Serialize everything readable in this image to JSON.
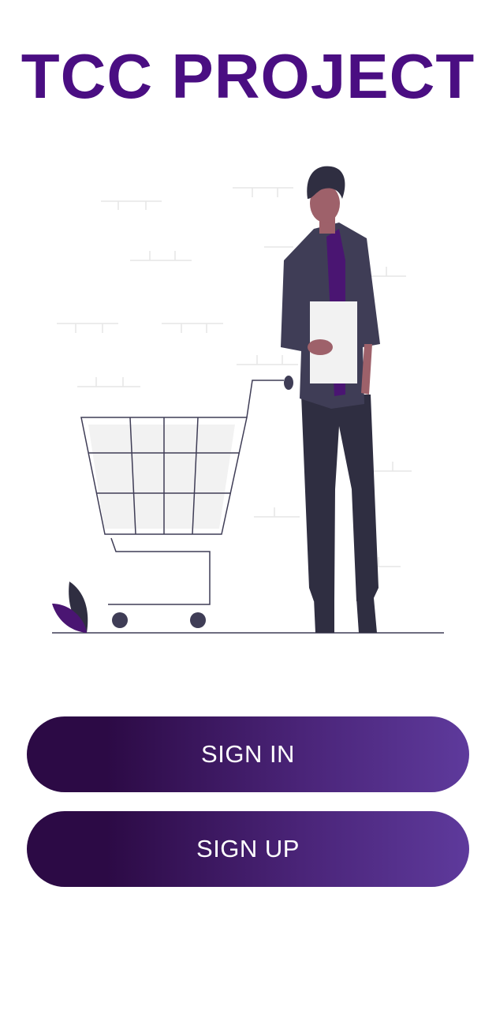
{
  "app": {
    "title": "TCC PROJECT",
    "title_color": "#4a0e82"
  },
  "illustration": {
    "description_icon": "shopping-person-icon"
  },
  "buttons": {
    "sign_in_label": "SIGN IN",
    "sign_up_label": "SIGN UP",
    "gradient_start": "#2c0a45",
    "gradient_end": "#5e3a9c"
  }
}
